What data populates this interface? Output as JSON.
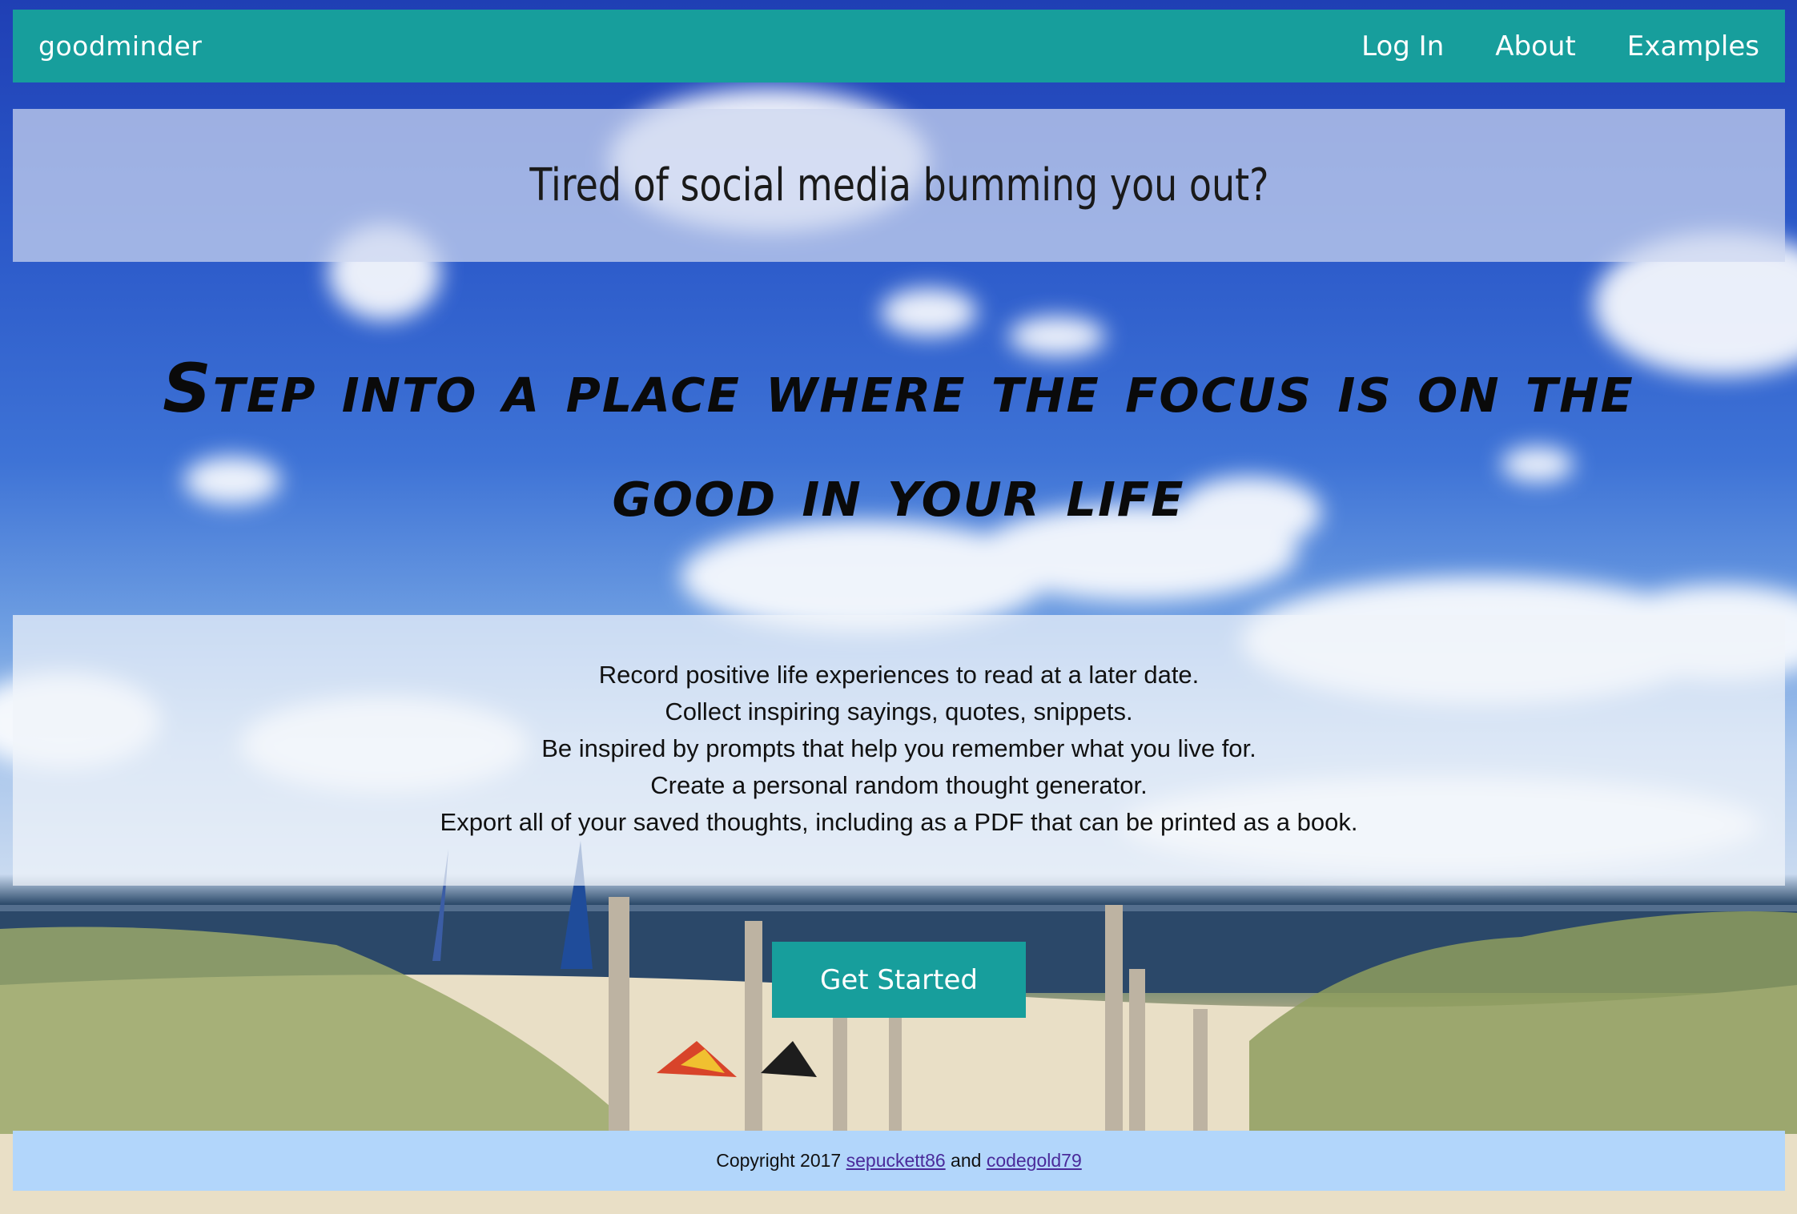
{
  "navbar": {
    "brand": "goodminder",
    "links": [
      {
        "label": "Log In"
      },
      {
        "label": "About"
      },
      {
        "label": "Examples"
      }
    ]
  },
  "banner": {
    "text": "Tired of social media bumming you out?"
  },
  "hero": {
    "line1": "Step into a place where the focus is on the",
    "line2": "good in your life"
  },
  "features": {
    "lines": [
      "Record positive life experiences to read at a later date.",
      "Collect inspiring sayings, quotes, snippets.",
      "Be inspired by prompts that help you remember what you live for.",
      "Create a personal random thought generator.",
      "Export all of your saved thoughts, including as a PDF that can be printed as a book."
    ]
  },
  "cta": {
    "label": "Get Started"
  },
  "footer": {
    "prefix": "Copyright 2017 ",
    "author1": "sepuckett86",
    "conjunction": " and ",
    "author2": "codegold79"
  },
  "colors": {
    "nav_bg": "#179e9c",
    "footer_bg": "#b2d6fb",
    "link": "#4a2a9a"
  },
  "background": {
    "scene": "beach-with-sky-clouds-sea-dunes"
  }
}
